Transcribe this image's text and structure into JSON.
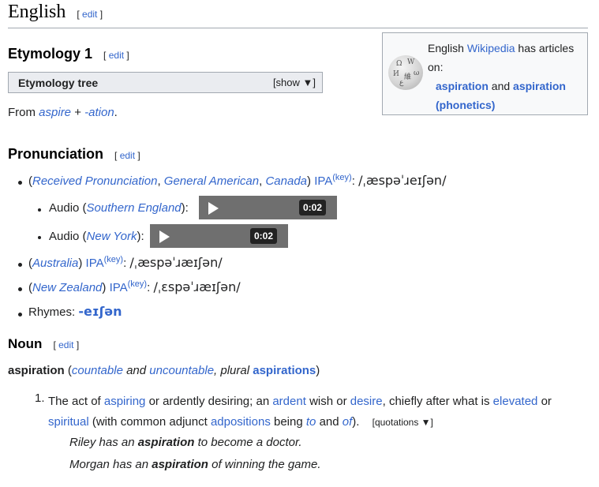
{
  "language": {
    "title": "English",
    "edit_prefix": "[",
    "edit_label": "edit",
    "edit_suffix": "]"
  },
  "etymology": {
    "heading": "Etymology 1",
    "tree": {
      "label": "Etymology tree",
      "show": "[show ▼]"
    },
    "text": {
      "from": "From",
      "link1": "aspire",
      "plus": "+",
      "link2": "-ation",
      "end": "."
    }
  },
  "wikipedia_box": {
    "line1_a": "English",
    "line1_link": "Wikipedia",
    "line1_b": "has articles",
    "line2": "on:",
    "link1": "aspiration",
    "and": "and",
    "link2": "aspiration",
    "link3": "(phonetics)"
  },
  "pronunciation": {
    "heading": "Pronunciation",
    "rp": {
      "open": "(",
      "l1": "Received Pronunciation",
      "c1": ",",
      "l2": "General American",
      "c2": ",",
      "l3": "Canada",
      "close": ")",
      "ipa": "IPA",
      "key": "(key)",
      "colon": ":",
      "value": "/ˌæspəˈɹeɪʃən/"
    },
    "audio1": {
      "label": "Audio (",
      "link": "Southern England",
      "end": "):",
      "time": "0:02"
    },
    "audio2": {
      "label": "Audio (",
      "link": "New York",
      "end": "):",
      "time": "0:02"
    },
    "au": {
      "open": "(",
      "link": "Australia",
      "close": ")",
      "ipa": "IPA",
      "key": "(key)",
      "colon": ":",
      "value": "/ˌæspəˈɹæɪʃən/"
    },
    "nz": {
      "open": "(",
      "link": "New Zealand",
      "close": ")",
      "ipa": "IPA",
      "key": "(key)",
      "colon": ":",
      "value": "/ˌɛspəˈɹæɪʃən/"
    },
    "rhymes": {
      "label": "Rhymes:",
      "value": "-eɪʃən"
    }
  },
  "noun": {
    "heading": "Noun",
    "headword": "aspiration",
    "open": "(",
    "countable": "countable",
    "and": "and",
    "uncountable": "uncountable",
    "plural_label": ", plural",
    "plural": "aspirations",
    "close": ")",
    "sense1": {
      "num": "1.",
      "t1": "The act of",
      "l1": "aspiring",
      "t2": "or ardently desiring; an",
      "l2": "ardent",
      "t3": "wish or",
      "l3": "desire",
      "t4": ", chiefly after what is",
      "l4": "elevated",
      "t5": "or",
      "l5": "spiritual",
      "t6": "(with common adjunct",
      "l6": "adpositions",
      "t7": "being",
      "l7": "to",
      "t8": "and",
      "l8": "of",
      "t9": ").",
      "quotations": "[quotations ▼]"
    },
    "examples": [
      {
        "pre": "Riley has an",
        "bold": "aspiration",
        "post": "to become a doctor."
      },
      {
        "pre": "Morgan has an",
        "bold": "aspiration",
        "post": "of winning the game."
      }
    ]
  }
}
